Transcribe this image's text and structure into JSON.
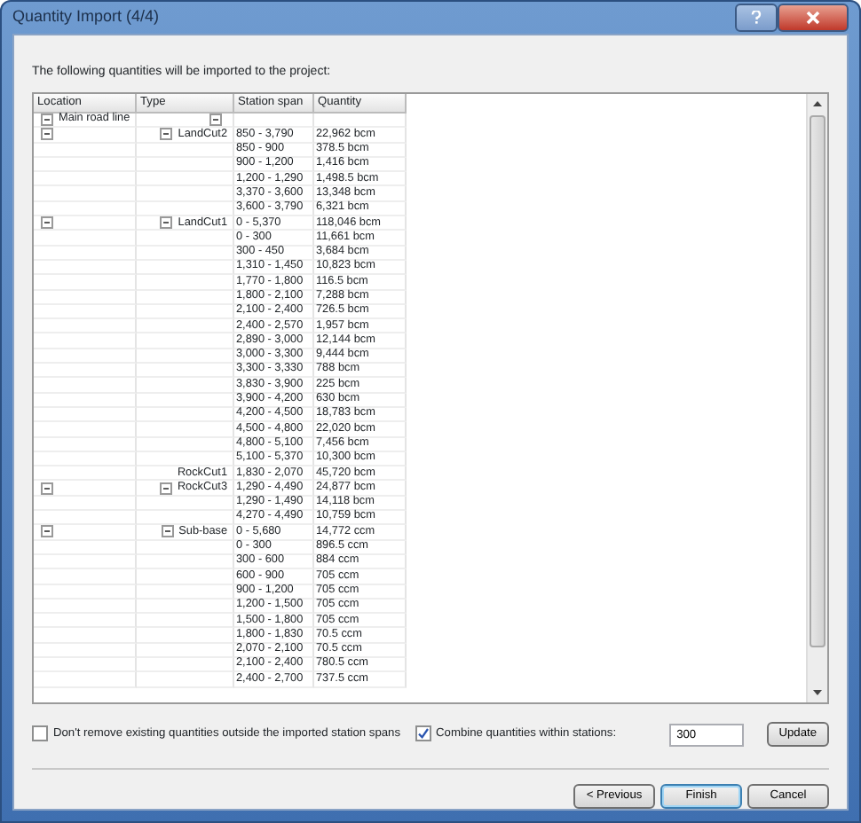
{
  "window": {
    "title": "Quantity Import (4/4)"
  },
  "intro": "The following quantities will be imported to the project:",
  "table": {
    "columns": [
      "Location",
      "Type",
      "Station span",
      "Quantity"
    ],
    "locations": [
      {
        "name": "Main road line",
        "expanded": true,
        "types": [
          {
            "name": "LandCut2",
            "expanded": true,
            "station_span": "850 - 3,790",
            "quantity": "22,962 bcm",
            "spans": [
              {
                "station_span": "850 - 900",
                "quantity": "378.5 bcm"
              },
              {
                "station_span": "900 - 1,200",
                "quantity": "1,416 bcm"
              },
              {
                "station_span": "1,200 - 1,290",
                "quantity": "1,498.5 bcm"
              },
              {
                "station_span": "3,370 - 3,600",
                "quantity": "13,348 bcm"
              },
              {
                "station_span": "3,600 - 3,790",
                "quantity": "6,321 bcm"
              }
            ]
          },
          {
            "name": "LandCut1",
            "expanded": true,
            "station_span": "0 - 5,370",
            "quantity": "118,046 bcm",
            "spans": [
              {
                "station_span": "0 - 300",
                "quantity": "11,661 bcm"
              },
              {
                "station_span": "300 - 450",
                "quantity": "3,684 bcm"
              },
              {
                "station_span": "1,310 - 1,450",
                "quantity": "10,823 bcm"
              },
              {
                "station_span": "1,770 - 1,800",
                "quantity": "116.5 bcm"
              },
              {
                "station_span": "1,800 - 2,100",
                "quantity": "7,288 bcm"
              },
              {
                "station_span": "2,100 - 2,400",
                "quantity": "726.5 bcm"
              },
              {
                "station_span": "2,400 - 2,570",
                "quantity": "1,957 bcm"
              },
              {
                "station_span": "2,890 - 3,000",
                "quantity": "12,144 bcm"
              },
              {
                "station_span": "3,000 - 3,300",
                "quantity": "9,444 bcm"
              },
              {
                "station_span": "3,300 - 3,330",
                "quantity": "788 bcm"
              },
              {
                "station_span": "3,830 - 3,900",
                "quantity": "225 bcm"
              },
              {
                "station_span": "3,900 - 4,200",
                "quantity": "630 bcm"
              },
              {
                "station_span": "4,200 - 4,500",
                "quantity": "18,783 bcm"
              },
              {
                "station_span": "4,500 - 4,800",
                "quantity": "22,020 bcm"
              },
              {
                "station_span": "4,800 - 5,100",
                "quantity": "7,456 bcm"
              },
              {
                "station_span": "5,100 - 5,370",
                "quantity": "10,300 bcm"
              }
            ]
          },
          {
            "name": "RockCut1",
            "station_span": "1,830 - 2,070",
            "quantity": "45,720 bcm"
          },
          {
            "name": "RockCut3",
            "expanded": true,
            "station_span": "1,290 - 4,490",
            "quantity": "24,877 bcm",
            "spans": [
              {
                "station_span": "1,290 - 1,490",
                "quantity": "14,118 bcm"
              },
              {
                "station_span": "4,270 - 4,490",
                "quantity": "10,759 bcm"
              }
            ]
          },
          {
            "name": "Sub-base",
            "expanded": true,
            "station_span": "0 - 5,680",
            "quantity": "14,772 ccm",
            "spans": [
              {
                "station_span": "0 - 300",
                "quantity": "896.5 ccm"
              },
              {
                "station_span": "300 - 600",
                "quantity": "884 ccm"
              },
              {
                "station_span": "600 - 900",
                "quantity": "705 ccm"
              },
              {
                "station_span": "900 - 1,200",
                "quantity": "705 ccm"
              },
              {
                "station_span": "1,200 - 1,500",
                "quantity": "705 ccm"
              },
              {
                "station_span": "1,500 - 1,800",
                "quantity": "705 ccm"
              },
              {
                "station_span": "1,800 - 1,830",
                "quantity": "70.5 ccm"
              },
              {
                "station_span": "2,070 - 2,100",
                "quantity": "70.5 ccm"
              },
              {
                "station_span": "2,100 - 2,400",
                "quantity": "780.5 ccm"
              },
              {
                "station_span": "2,400 - 2,700",
                "quantity": "737.5 ccm"
              }
            ]
          }
        ]
      }
    ]
  },
  "options": [
    {
      "label": "Don't remove existing quantities outside the imported station spans",
      "checked": false
    },
    {
      "label": "Combine quantities within stations:",
      "checked": true
    }
  ],
  "station_field": {
    "value": "300"
  },
  "update_button": "Update",
  "buttons": [
    "< Previous",
    "Finish",
    "Cancel"
  ]
}
